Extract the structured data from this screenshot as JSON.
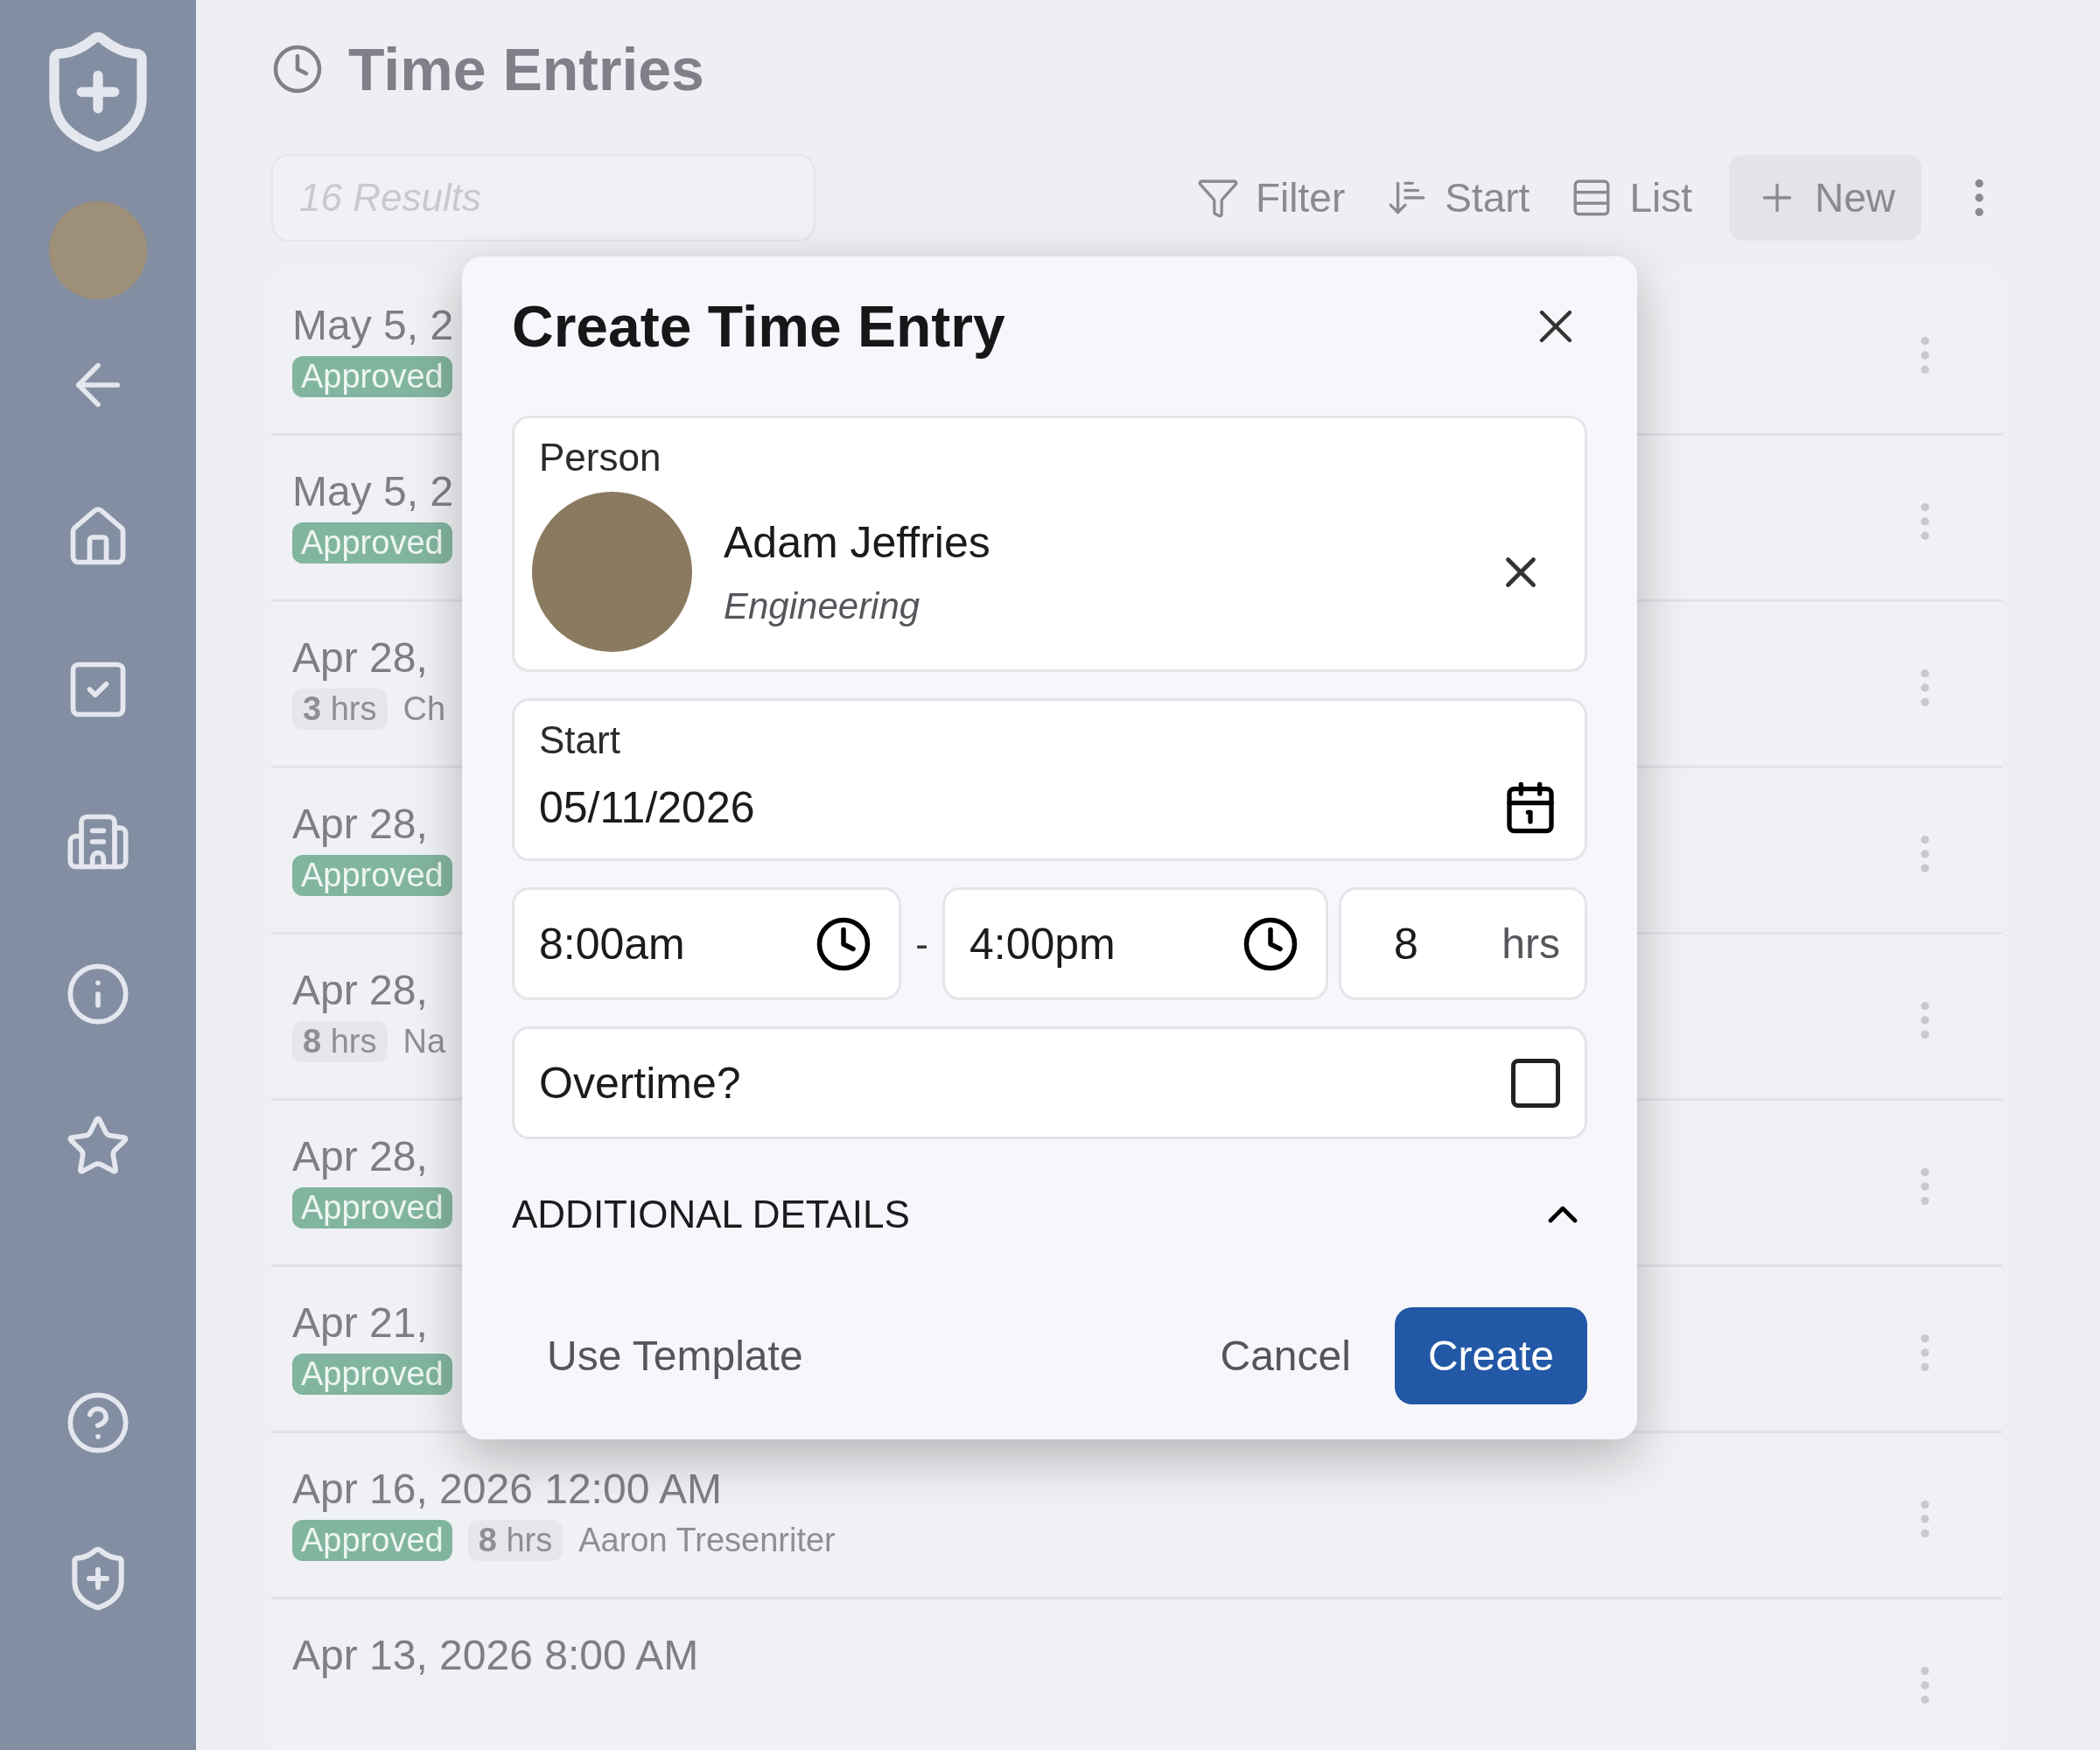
{
  "page": {
    "title": "Time Entries"
  },
  "search": {
    "placeholder": "16 Results"
  },
  "toolbar": [
    {
      "label": "Filter",
      "kind": "filter"
    },
    {
      "label": "Start",
      "kind": "sort"
    },
    {
      "label": "List",
      "kind": "view"
    },
    {
      "label": "New",
      "kind": "new"
    }
  ],
  "rows": [
    {
      "date": "May 5, 2",
      "status": "Approved"
    },
    {
      "date": "May 5, 2",
      "status": "Approved"
    },
    {
      "date": "Apr 28,",
      "hours": "3",
      "unit": "hrs",
      "person": "Ch"
    },
    {
      "date": "Apr 28,",
      "status": "Approved"
    },
    {
      "date": "Apr 28,",
      "hours": "8",
      "unit": "hrs",
      "person": "Na"
    },
    {
      "date": "Apr 28,",
      "status": "Approved"
    },
    {
      "date": "Apr 21,",
      "status": "Approved"
    },
    {
      "date": "Apr 16, 2026 12:00 AM",
      "status": "Approved",
      "hours": "8",
      "unit": "hrs",
      "person": "Aaron Tresenriter"
    },
    {
      "date": "Apr 13, 2026 8:00 AM"
    }
  ],
  "dialog": {
    "title": "Create Time Entry",
    "person": {
      "label": "Person",
      "name": "Adam Jeffries",
      "department": "Engineering"
    },
    "start": {
      "label": "Start",
      "value": "05/11/2026"
    },
    "time": {
      "from": "8:00am",
      "separator": "-",
      "to": "4:00pm",
      "hours": "8",
      "unit": "hrs"
    },
    "overtime": {
      "label": "Overtime?",
      "checked": false
    },
    "details": {
      "label": "ADDITIONAL DETAILS",
      "expanded": true
    },
    "buttons": [
      {
        "label": "Use Template",
        "kind": "text"
      },
      {
        "label": "Cancel",
        "kind": "text"
      },
      {
        "label": "Create",
        "kind": "primary"
      }
    ]
  }
}
